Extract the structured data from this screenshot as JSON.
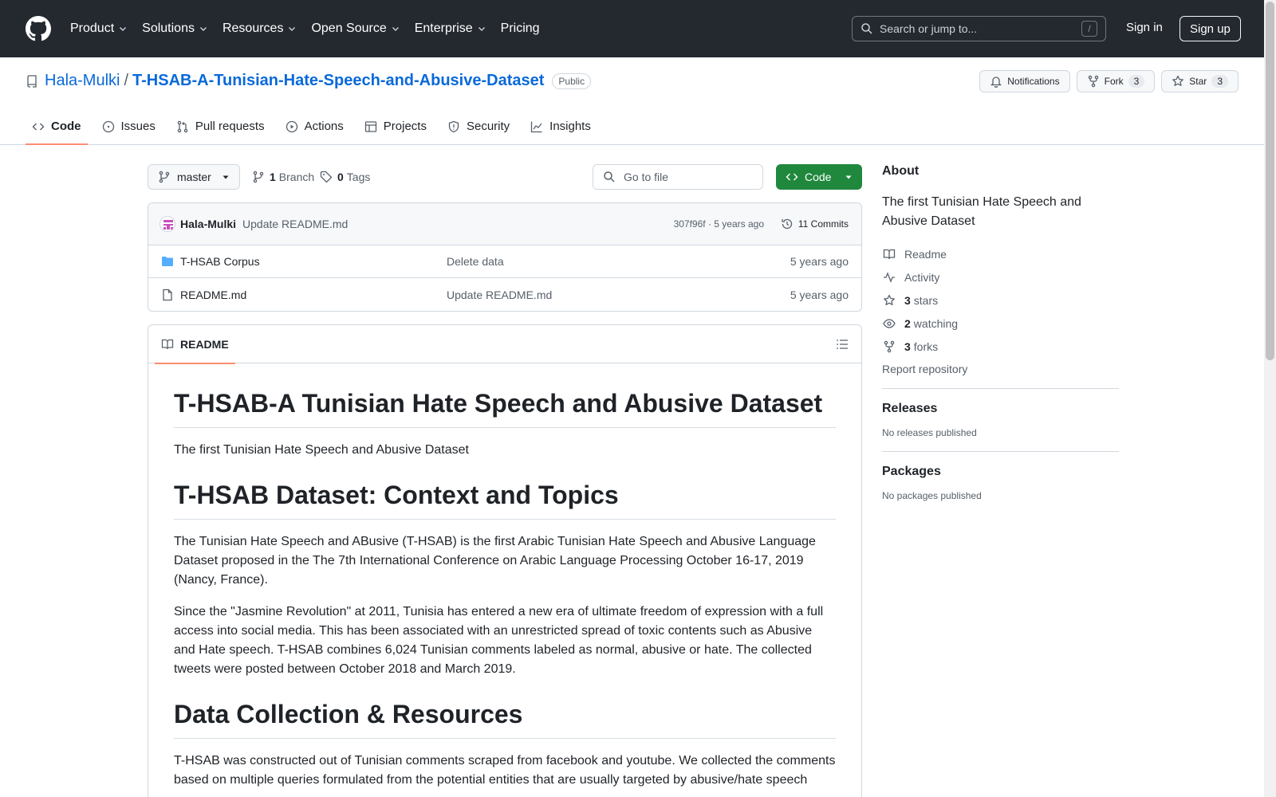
{
  "header": {
    "nav": [
      "Product",
      "Solutions",
      "Resources",
      "Open Source",
      "Enterprise",
      "Pricing"
    ],
    "search_placeholder": "Search or jump to...",
    "slash": "/",
    "signin": "Sign in",
    "signup": "Sign up"
  },
  "repo": {
    "owner": "Hala-Mulki",
    "separator": "/",
    "name": "T-HSAB-A-Tunisian-Hate-Speech-and-Abusive-Dataset",
    "visibility": "Public",
    "notifications": "Notifications",
    "fork_label": "Fork",
    "fork_count": "3",
    "star_label": "Star",
    "star_count": "3"
  },
  "tabs": [
    "Code",
    "Issues",
    "Pull requests",
    "Actions",
    "Projects",
    "Security",
    "Insights"
  ],
  "toolbar": {
    "branch": "master",
    "branch_count": "1",
    "branch_label": "Branch",
    "tag_count": "0",
    "tag_label": "Tags",
    "goto_placeholder": "Go to file",
    "code_label": "Code"
  },
  "commit": {
    "author": "Hala-Mulki",
    "message": "Update README.md",
    "sha_age": "307f96f · 5 years ago",
    "commits": "11 Commits"
  },
  "files": [
    {
      "type": "folder",
      "name": "T-HSAB Corpus",
      "message": "Delete data",
      "age": "5 years ago"
    },
    {
      "type": "file",
      "name": "README.md",
      "message": "Update README.md",
      "age": "5 years ago"
    }
  ],
  "readme": {
    "tab": "README",
    "h1": "T-HSAB-A Tunisian Hate Speech and Abusive Dataset",
    "p1": "The first Tunisian Hate Speech and Abusive Dataset",
    "h2": "T-HSAB Dataset: Context and Topics",
    "p2": "The Tunisian Hate Speech and ABusive (T-HSAB) is the first Arabic Tunisian Hate Speech and Abusive Language Dataset proposed in the The 7th International Conference on Arabic Language Processing October 16-17, 2019 (Nancy, France).",
    "p3": "Since the \"Jasmine Revolution\" at 2011, Tunisia has entered a new era of ultimate freedom of expression with a full access into social media. This has been associated with an unrestricted spread of toxic contents such as Abusive and Hate speech. T-HSAB combines 6,024 Tunisian comments labeled as normal, abusive or hate. The collected tweets were posted between October 2018 and March 2019.",
    "h3": "Data Collection & Resources",
    "p4": "T-HSAB was constructed out of Tunisian comments scraped from facebook and youtube. We collected the comments based on multiple queries formulated from the potential entities that are usually targeted by abusive/hate speech"
  },
  "about": {
    "title": "About",
    "description": "The first Tunisian Hate Speech and Abusive Dataset",
    "readme": "Readme",
    "activity": "Activity",
    "stars_count": "3",
    "stars_label": "stars",
    "watching_count": "2",
    "watching_label": "watching",
    "forks_count": "3",
    "forks_label": "forks",
    "report": "Report repository"
  },
  "releases": {
    "title": "Releases",
    "empty": "No releases published"
  },
  "packages": {
    "title": "Packages",
    "empty": "No packages published"
  }
}
